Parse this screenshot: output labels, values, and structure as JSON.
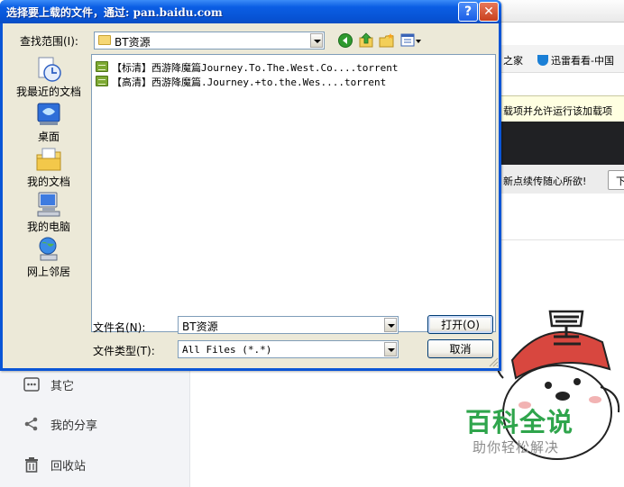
{
  "dialog": {
    "title": "选择要上载的文件，通过: pan.baidu.com",
    "help_label": "?",
    "close_label": "✕",
    "lookin_label": "查找范围(I):",
    "lookin_value": "BT资源",
    "toolbar_icons": [
      "back-icon",
      "up-folder-icon",
      "new-folder-icon",
      "view-menu-icon"
    ],
    "places": [
      {
        "label": "我最近的文档",
        "icon": "recent-documents-icon"
      },
      {
        "label": "桌面",
        "icon": "desktop-icon"
      },
      {
        "label": "我的文档",
        "icon": "my-documents-icon"
      },
      {
        "label": "我的电脑",
        "icon": "my-computer-icon"
      },
      {
        "label": "网上邻居",
        "icon": "network-places-icon"
      }
    ],
    "files": [
      {
        "name": "【标清】西游降魔篇Journey.To.The.West.Co....torrent"
      },
      {
        "name": "【高清】西游降魔篇.Journey.+to.the.Wes....torrent"
      }
    ],
    "filename_label": "文件名(N):",
    "filename_value": "BT资源",
    "filetype_label": "文件类型(T):",
    "filetype_value": "All Files (*.*)",
    "open_label": "打开(O)",
    "cancel_label": "取消"
  },
  "background": {
    "favorites": {
      "item1": "之家",
      "item2": "迅雷看看-中国"
    },
    "infobar_text": "载项并允许运行该加载项",
    "strip_text": "新点续传随心所欲!",
    "strip_button": "下"
  },
  "sidebar": {
    "items": [
      {
        "label": "其它",
        "icon": "more-icon"
      },
      {
        "label": "我的分享",
        "icon": "share-icon"
      },
      {
        "label": "回收站",
        "icon": "trash-icon"
      }
    ]
  },
  "watermark": {
    "title": "百科全说",
    "subtitle": "助你轻松解决"
  },
  "colors": {
    "titlebar": "#0a55d6",
    "dialog_face": "#ece9d8",
    "watermark_green": "#2fa54c"
  }
}
